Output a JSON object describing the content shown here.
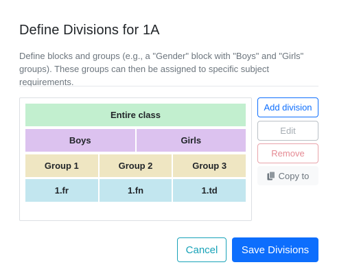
{
  "dialog": {
    "title": "Define Divisions for 1A",
    "description": "Define blocks and groups (e.g., a \"Gender\" block with \"Boys\" and \"Girls\" groups). These groups can then be assigned to specific subject requirements."
  },
  "divisions": {
    "entire_row": [
      "Entire class"
    ],
    "gender_row": [
      "Boys",
      "Girls"
    ],
    "group_row": [
      "Group 1",
      "Group 2",
      "Group 3"
    ],
    "subject_row": [
      "1.fr",
      "1.fn",
      "1.td"
    ]
  },
  "actions": {
    "add_label": "Add division",
    "edit_label": "Edit",
    "remove_label": "Remove",
    "copy_label": "Copy to",
    "copy_icon": "copy-icon"
  },
  "footer": {
    "cancel_label": "Cancel",
    "save_label": "Save Divisions"
  },
  "colors": {
    "primary": "#0d6efd",
    "cancel_outline": "#17a2b8",
    "entire_row": "#c2efcf",
    "gender_row": "#dcc2ef",
    "group_row": "#efe6c2",
    "subject_row": "#c2e6ef",
    "remove_outline": "#e8a3aa"
  }
}
